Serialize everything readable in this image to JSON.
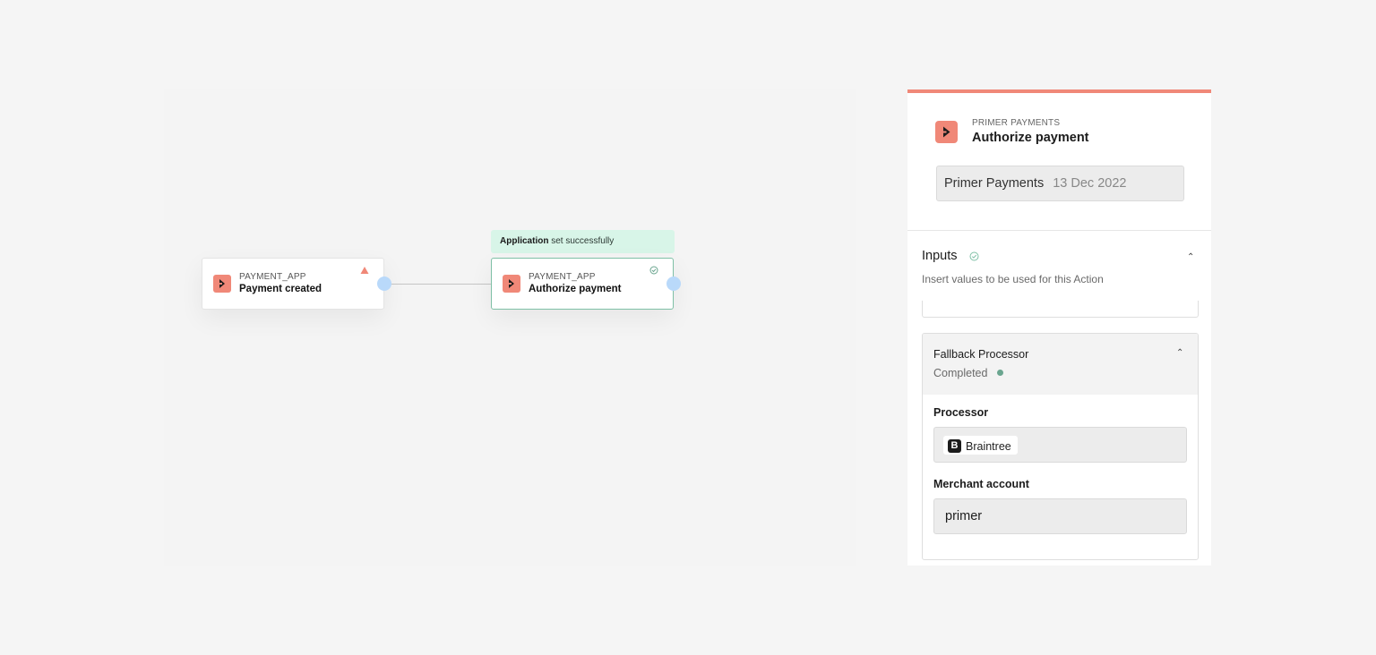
{
  "canvas": {
    "nodes": [
      {
        "app": "PAYMENT_APP",
        "title": "Payment created",
        "status": "warning-icon"
      },
      {
        "app": "PAYMENT_APP",
        "title": "Authorize payment",
        "status": "check-circle-icon"
      }
    ],
    "toast": {
      "strong": "Application",
      "rest": " set successfully"
    }
  },
  "panel": {
    "app": "PRIMER PAYMENTS",
    "title": "Authorize payment",
    "version": {
      "name": "Primer Payments",
      "date": "13 Dec 2022"
    },
    "inputs": {
      "title": "Inputs",
      "subtitle": "Insert values to be used for this Action",
      "chevron": "⌃"
    },
    "group": {
      "title": "Fallback Processor",
      "status": "Completed",
      "chevron": "⌃",
      "fields": [
        {
          "label": "Processor",
          "chip_logo": "B",
          "value": "Braintree"
        },
        {
          "label": "Merchant account",
          "value": "primer"
        }
      ]
    }
  },
  "colors": {
    "accent": "#f08878",
    "success": "#6aa58f",
    "port": "#b9d9fa",
    "toast_bg": "#d8f5e8"
  }
}
